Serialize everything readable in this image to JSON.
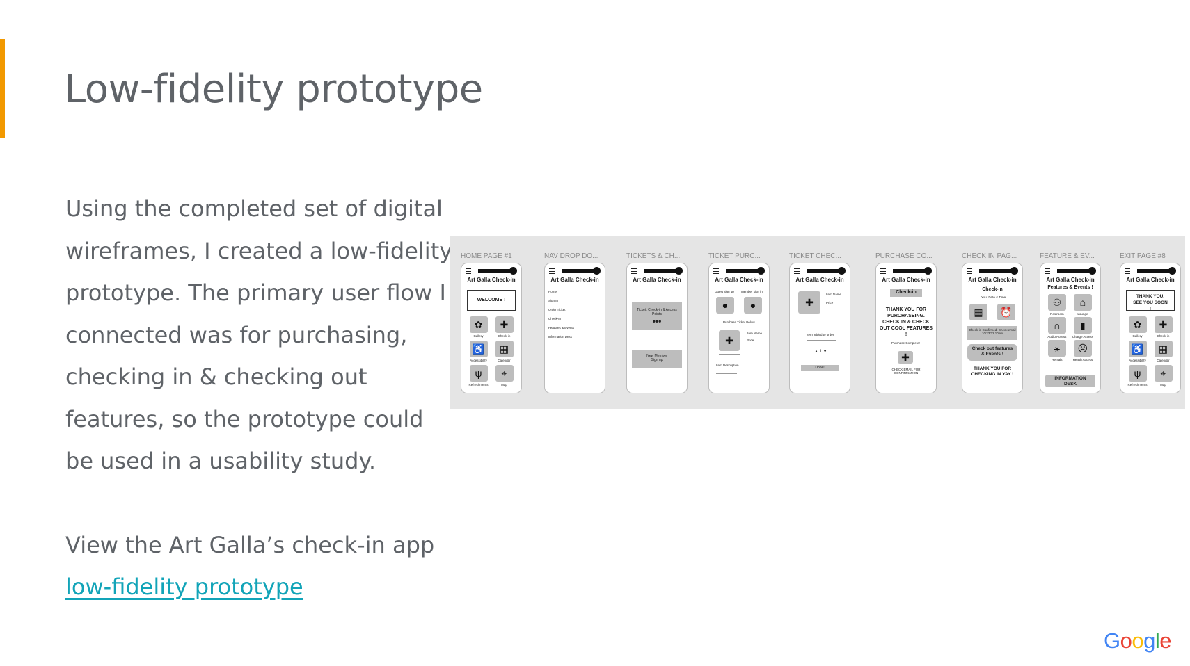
{
  "slide": {
    "title": "Low-fidelity prototype",
    "paragraph": "Using the completed set of digital wireframes, I created a low-fidelity prototype. The primary user flow I connected was for purchasing, checking in & checking out features, so the prototype could be used in a usability study.",
    "view_text": "View the Art Galla’s check-in app",
    "link_text": "low-fidelity prototype",
    "accent_color": "#f29900",
    "link_color": "#12a4b8"
  },
  "prototype": {
    "app_title": "Art Galla Check-in",
    "frames": [
      {
        "label": "HOME PAGE #1"
      },
      {
        "label": "NAV DROP DO..."
      },
      {
        "label": "TICKETS & CH..."
      },
      {
        "label": "TICKET PURC..."
      },
      {
        "label": "TICKET CHEC..."
      },
      {
        "label": "PURCHASE CO..."
      },
      {
        "label": "CHECK IN PAG..."
      },
      {
        "label": "FEATURE & EV..."
      },
      {
        "label": "EXIT PAGE #8"
      }
    ],
    "home": {
      "welcome": "WELCOME !",
      "tiles": [
        "Gallery",
        "Check-in",
        "Accessibility",
        "Calendar",
        "Refreshments",
        "Map"
      ]
    },
    "nav_menu": [
      "Home",
      "Sign In",
      "Order Ticket",
      "Check-In",
      "Features & Events",
      "Information Desk"
    ],
    "tickets": {
      "box1": "Ticket, Check-in & Access Points",
      "box2_line1": "New Member",
      "box2_line2": "Sign up"
    },
    "purchase": {
      "guest": "Guest sign up",
      "member": "Member sign in",
      "prompt": "Purchase Ticket Below",
      "item_name": "Item Name",
      "price": "Price",
      "item_desc": "Item Description"
    },
    "checkout": {
      "item_name": "Item Name",
      "price": "Price",
      "added": "Item added to order",
      "qty": "▲ 1 ▼",
      "done": "Done!"
    },
    "purchase_complete": {
      "badge": "Check-in",
      "thanks": "THANK YOU FOR PURCHASEING. CHECK IN & CHECK OUT COOL FEATURES !",
      "status": "Purchase Complete!",
      "email": "CHECK EMAIL FOR CONFIRMATION"
    },
    "checkin": {
      "heading": "Check-in",
      "sub": "Your Date & Time",
      "confirm": "Check-in Confirmed. Check email 10/23/22 10pm",
      "cta": "Check out features & Events !",
      "thanks": "THANK YOU FOR CHECKING IN YAY !"
    },
    "features": {
      "heading": "Features & Events !",
      "tiles": [
        "Restroom",
        "Lounge",
        "Audio Access",
        "Charge Access",
        "Rentals",
        "Health Access"
      ],
      "info": "INFORMATION DESK"
    },
    "exit": {
      "thanks": "THANK YOU. SEE YOU SOON !",
      "tiles": [
        "Gallery",
        "Check-in",
        "Accessibility",
        "Calendar",
        "Refreshments",
        "Map"
      ]
    }
  },
  "branding": {
    "logo_letters": [
      "G",
      "o",
      "o",
      "g",
      "l",
      "e"
    ]
  }
}
